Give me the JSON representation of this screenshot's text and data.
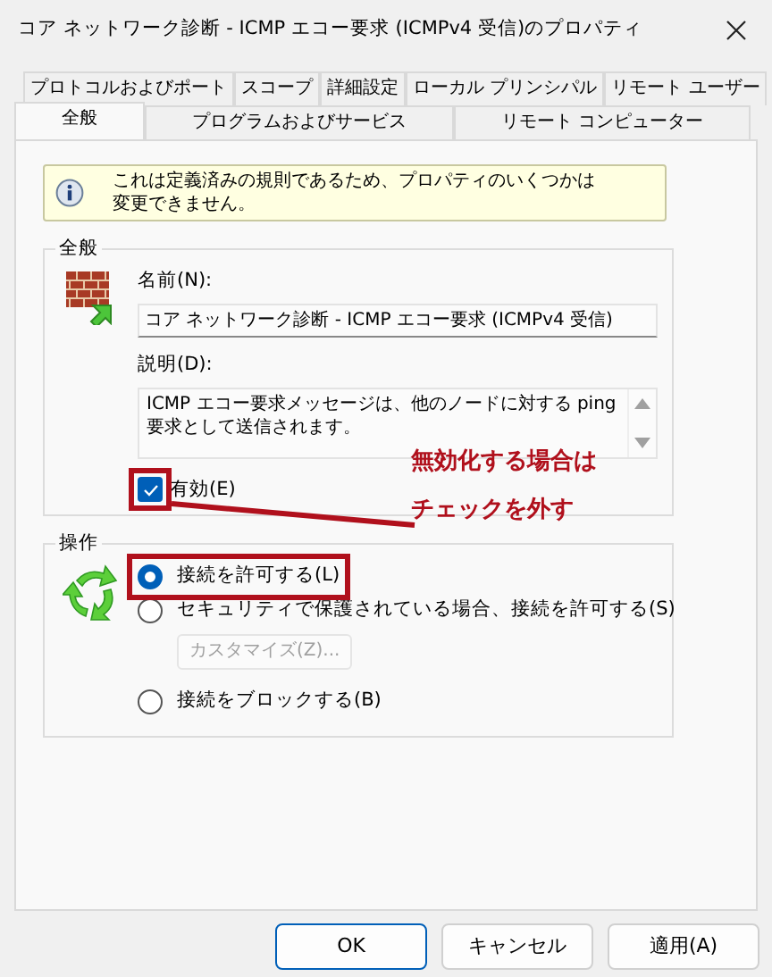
{
  "window": {
    "title": "コア ネットワーク診断 - ICMP エコー要求 (ICMPv4 受信)のプロパティ"
  },
  "tab_rows": [
    [
      {
        "label": "プロトコルおよびポート",
        "selected": false
      },
      {
        "label": "スコープ",
        "selected": false
      },
      {
        "label": "詳細設定",
        "selected": false
      },
      {
        "label": "ローカル プリンシパル",
        "selected": false
      },
      {
        "label": "リモート ユーザー",
        "selected": false
      }
    ],
    [
      {
        "label": "全般",
        "selected": true
      },
      {
        "label": "プログラムおよびサービス",
        "selected": false
      },
      {
        "label": "リモート コンピューター",
        "selected": false
      }
    ]
  ],
  "info_message": "これは定義済みの規則であるため、プロパティのいくつかは変更できません。",
  "general_group": {
    "title": "全般",
    "name_label": "名前(N):",
    "name_value": "コア ネットワーク診断 - ICMP エコー要求 (ICMPv4 受信)",
    "description_label": "説明(D):",
    "description_value": "ICMP エコー要求メッセージは、他のノードに対する ping\n要求として送信されます。",
    "enabled": {
      "label": "有効(E)",
      "checked": true
    }
  },
  "action_group": {
    "title": "操作",
    "options": [
      {
        "label": "接続を許可する(L)",
        "selected": true
      },
      {
        "label": "セキュリティで保護されている場合、接続を許可する(S)",
        "selected": false
      },
      {
        "label": "接続をブロックする(B)",
        "selected": false
      }
    ],
    "customize_button": {
      "label": "カスタマイズ(Z)...",
      "disabled": true
    }
  },
  "annotation": {
    "lines": [
      "無効化する場合は",
      "チェックを外す"
    ]
  },
  "buttons": [
    {
      "label": "OK",
      "default": true
    },
    {
      "label": "キャンセル",
      "default": false
    },
    {
      "label": "適用(A)",
      "default": false
    }
  ]
}
